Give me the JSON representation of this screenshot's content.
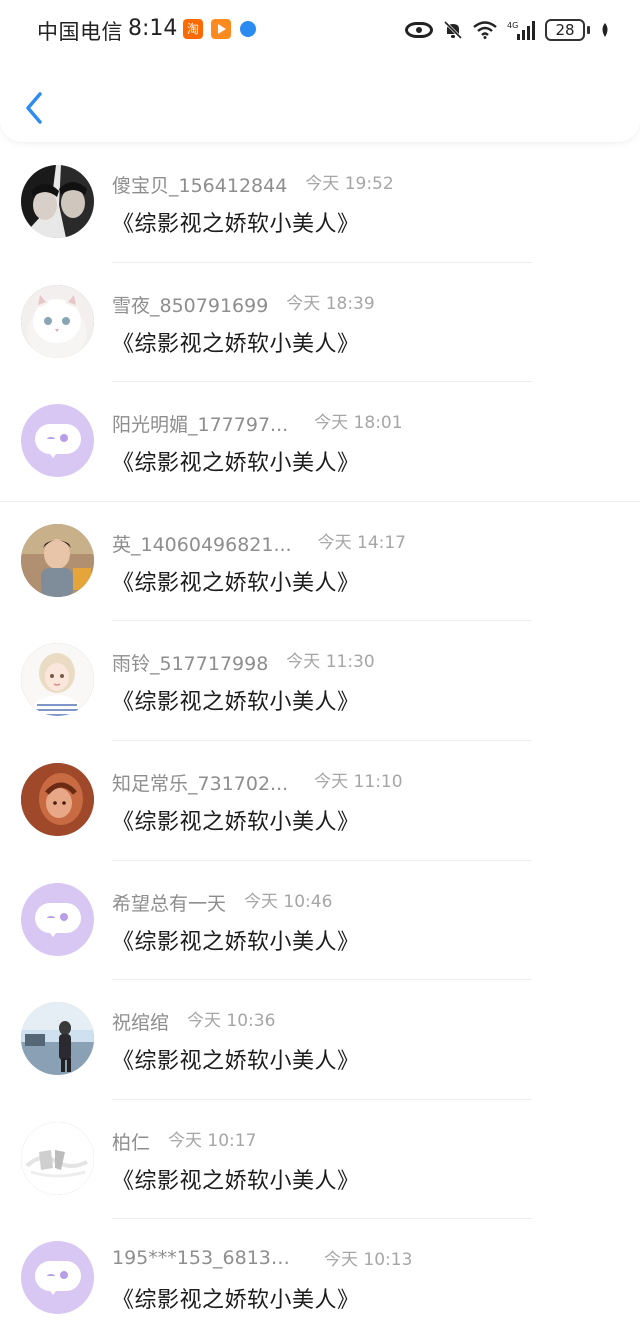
{
  "status_bar": {
    "carrier": "中国电信",
    "time": "8:14",
    "taobao_badge": "淘",
    "battery": "28",
    "network": "4G"
  },
  "header": {
    "back_icon": "chevron-left-icon",
    "accent_color": "#2f8cf0"
  },
  "messages": [
    {
      "name": "傻宝贝_156412844",
      "time": "今天 19:52",
      "text": "《综影视之娇软小美人》",
      "avatar": "photo"
    },
    {
      "name": "雪夜_850791699",
      "time": "今天 18:39",
      "text": "《综影视之娇软小美人》",
      "avatar": "photo"
    },
    {
      "name": "阳光明媚_177797...",
      "time": "今天 18:01",
      "text": "《综影视之娇软小美人》",
      "avatar": "default"
    },
    {
      "name": "英_14060496821...",
      "time": "今天 14:17",
      "text": "《综影视之娇软小美人》",
      "avatar": "photo"
    },
    {
      "name": "雨铃_517717998",
      "time": "今天 11:30",
      "text": "《综影视之娇软小美人》",
      "avatar": "photo"
    },
    {
      "name": "知足常乐_731702...",
      "time": "今天 11:10",
      "text": "《综影视之娇软小美人》",
      "avatar": "photo"
    },
    {
      "name": "希望总有一天",
      "time": "今天 10:46",
      "text": "《综影视之娇软小美人》",
      "avatar": "default"
    },
    {
      "name": "祝绾绾",
      "time": "今天 10:36",
      "text": "《综影视之娇软小美人》",
      "avatar": "photo"
    },
    {
      "name": "柏仁",
      "time": "今天 10:17",
      "text": "《综影视之娇软小美人》",
      "avatar": "photo"
    },
    {
      "name": "195***153_68138...",
      "time": "今天 10:13",
      "text": "《综影视之娇软小美人》",
      "avatar": "default"
    }
  ],
  "colors": {
    "default_avatar": "#d9c7f3",
    "name_text": "#8e8e8e",
    "time_text": "#a6a6a6"
  }
}
